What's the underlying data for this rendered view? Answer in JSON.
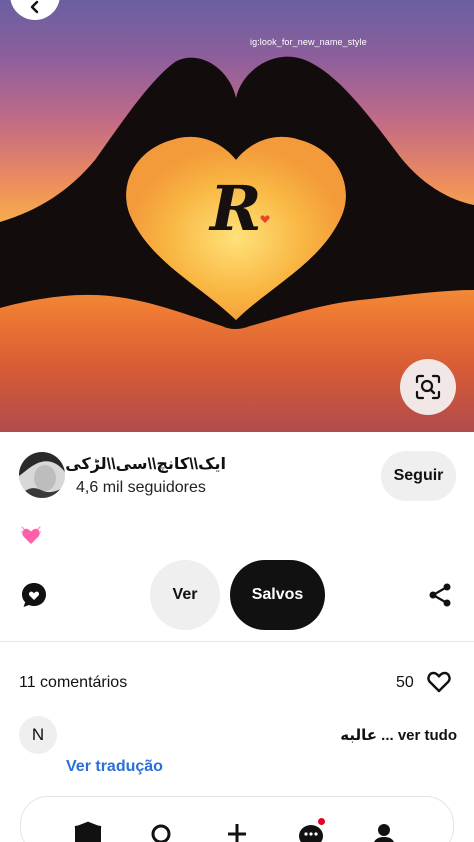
{
  "pin": {
    "watermark": "ig:look_for_new_name_style",
    "monogram": "R"
  },
  "author": {
    "name": "ایک\\\\کانچ\\\\سی\\\\لڑکی",
    "followers": "4,6 mil seguidores",
    "follow_label": "Seguir"
  },
  "description": {
    "emoji": "💓"
  },
  "actions": {
    "view_label": "Ver",
    "save_label": "Salvos"
  },
  "comments": {
    "count_label": "11 comentários",
    "likes": "50",
    "items": [
      {
        "avatar_initial": "N",
        "text": "عالبه ... ver tudo",
        "translate_label": "Ver tradução"
      }
    ]
  },
  "nav": {
    "items": [
      "home-icon",
      "search-icon",
      "create-icon",
      "messages-icon",
      "profile-icon"
    ]
  },
  "colors": {
    "accent": "#e60023",
    "link": "#2b6fd8",
    "save_button": "#111111"
  }
}
